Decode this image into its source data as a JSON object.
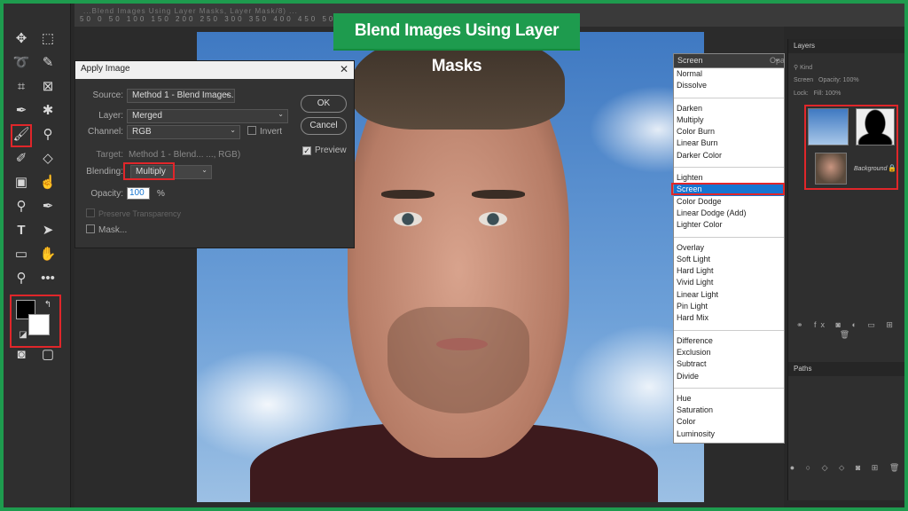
{
  "banner": {
    "title": "Blend Images Using Layer Masks"
  },
  "topbar": {
    "text": "...Blend Images Using Layer Masks, Layer Mask/8) ..."
  },
  "ruler": {
    "marks": "50 0 50 100 150 200 250 300 350 400 450 500 550 600 650 700 750"
  },
  "toolbar": {
    "tools": [
      "move",
      "marquee",
      "lasso",
      "quick-select",
      "crop",
      "frame",
      "eyedropper",
      "patch",
      "brush",
      "stamp",
      "history-brush",
      "eraser",
      "gradient",
      "smudge",
      "dodge",
      "pen",
      "type",
      "path-select",
      "rectangle",
      "hand",
      "zoom",
      "more"
    ]
  },
  "dialog": {
    "title": "Apply Image",
    "close": "✕",
    "source_label": "Source:",
    "source_value": "Method 1 - Blend Images...",
    "layer_label": "Layer:",
    "layer_value": "Merged",
    "channel_label": "Channel:",
    "channel_value": "RGB",
    "invert_label": "Invert",
    "target_label": "Target:",
    "target_value": "Method 1 - Blend... ..., RGB)",
    "blending_label": "Blending:",
    "blending_value": "Multiply",
    "opacity_label": "Opacity:",
    "opacity_value": "100",
    "opacity_unit": "%",
    "preserve_label": "Preserve Transparency",
    "mask_label": "Mask...",
    "ok_label": "OK",
    "cancel_label": "Cancel",
    "preview_label": "Preview"
  },
  "blend_menu": {
    "current": "Screen",
    "opacity_label": "Opa",
    "groups": [
      [
        "Normal",
        "Dissolve"
      ],
      [
        "Darken",
        "Multiply",
        "Color Burn",
        "Linear Burn",
        "Darker Color"
      ],
      [
        "Lighten",
        "Screen",
        "Color Dodge",
        "Linear Dodge (Add)",
        "Lighter Color"
      ],
      [
        "Overlay",
        "Soft Light",
        "Hard Light",
        "Vivid Light",
        "Linear Light",
        "Pin Light",
        "Hard Mix"
      ],
      [
        "Difference",
        "Exclusion",
        "Subtract",
        "Divide"
      ],
      [
        "Hue",
        "Saturation",
        "Color",
        "Luminosity"
      ]
    ],
    "selected": "Screen"
  },
  "layers_panel": {
    "tab": "Layers",
    "kind": "Kind",
    "mode": "Screen",
    "opacity": "Opacity: 100%",
    "lock": "Lock:",
    "fill": "Fill: 100%",
    "background_label": "Background"
  },
  "paths_panel": {
    "tab": "Paths"
  },
  "colors": {
    "highlight": "#e0262a",
    "banner": "#1e9b4e",
    "selected": "#1675d1"
  }
}
